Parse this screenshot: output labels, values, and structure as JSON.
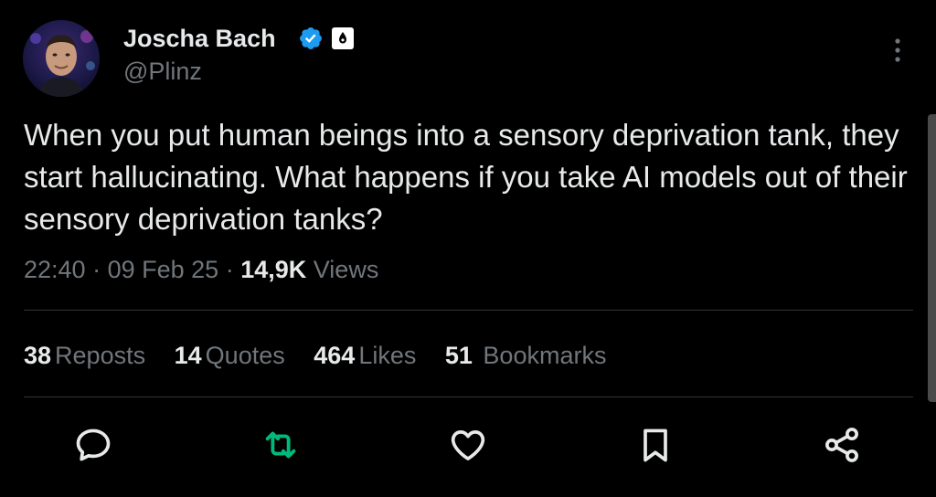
{
  "author": {
    "display_name": "Joscha Bach",
    "handle": "@Plinz",
    "verified": true,
    "badge_color": "#1d9bf0"
  },
  "tweet": {
    "text": "When you put human beings into a sensory deprivation tank, they start hallucinating. What happens if you take AI models out of their sensory deprivation tanks?",
    "time": "22:40",
    "date": "09 Feb 25",
    "views_count": "14,9K",
    "views_label": "Views"
  },
  "stats": {
    "reposts": {
      "count": "38",
      "label": "Reposts"
    },
    "quotes": {
      "count": "14",
      "label": "Quotes"
    },
    "likes": {
      "count": "464",
      "label": "Likes"
    },
    "bookmarks": {
      "count": "51",
      "label": "Bookmarks"
    }
  },
  "actions": {
    "reply_icon": "speech-bubble-icon",
    "repost_icon": "repost-icon",
    "like_icon": "heart-icon",
    "bookmark_icon": "bookmark-icon",
    "share_icon": "share-icon",
    "repost_active_color": "#00ba7c",
    "icon_color": "#e7e9ea"
  },
  "menu": {
    "icon": "more-vertical-icon"
  }
}
